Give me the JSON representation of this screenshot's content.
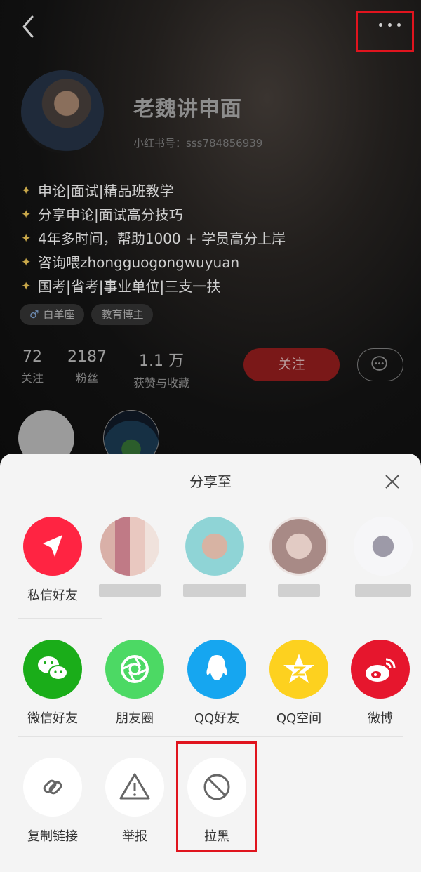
{
  "profile": {
    "name": "老魏讲申面",
    "red_id": "小红书号：sss784856939",
    "bio": [
      "申论|面试|精品班教学",
      "分享申论|面试高分技巧",
      "4年多时间，帮助1000 + 学员高分上岸",
      "咨询喂zhongguogongwuyuan",
      "国考|省考|事业单位|三支一扶"
    ],
    "bio_icon": "sparkle-icon",
    "tags": [
      {
        "label": "白羊座",
        "icon": "male-icon"
      },
      {
        "label": "教育博主"
      }
    ],
    "stats": [
      {
        "value": "72",
        "label": "关注"
      },
      {
        "value": "2187",
        "label": "粉丝"
      },
      {
        "value": "1.1 万",
        "label": "获赞与收藏"
      }
    ],
    "follow_label": "关注"
  },
  "share": {
    "title": "分享至",
    "friends": [
      {
        "label": "私信好友",
        "icon": "send-icon",
        "color": "#ff2442"
      }
    ],
    "apps": [
      {
        "label": "微信好友",
        "icon": "wechat-icon",
        "color": "#1aad19"
      },
      {
        "label": "朋友圈",
        "icon": "moments-icon",
        "color": "#4cd964"
      },
      {
        "label": "QQ好友",
        "icon": "qq-icon",
        "color": "#16a6f0"
      },
      {
        "label": "QQ空间",
        "icon": "qzone-icon",
        "color": "#fdd11f"
      },
      {
        "label": "微博",
        "icon": "weibo-icon",
        "color": "#e6162d"
      }
    ],
    "actions": [
      {
        "label": "复制链接",
        "icon": "link-icon"
      },
      {
        "label": "举报",
        "icon": "warning-icon"
      },
      {
        "label": "拉黑",
        "icon": "block-icon"
      }
    ]
  },
  "colors": {
    "accent": "#ff2442",
    "highlight_box": "#e0141e"
  }
}
